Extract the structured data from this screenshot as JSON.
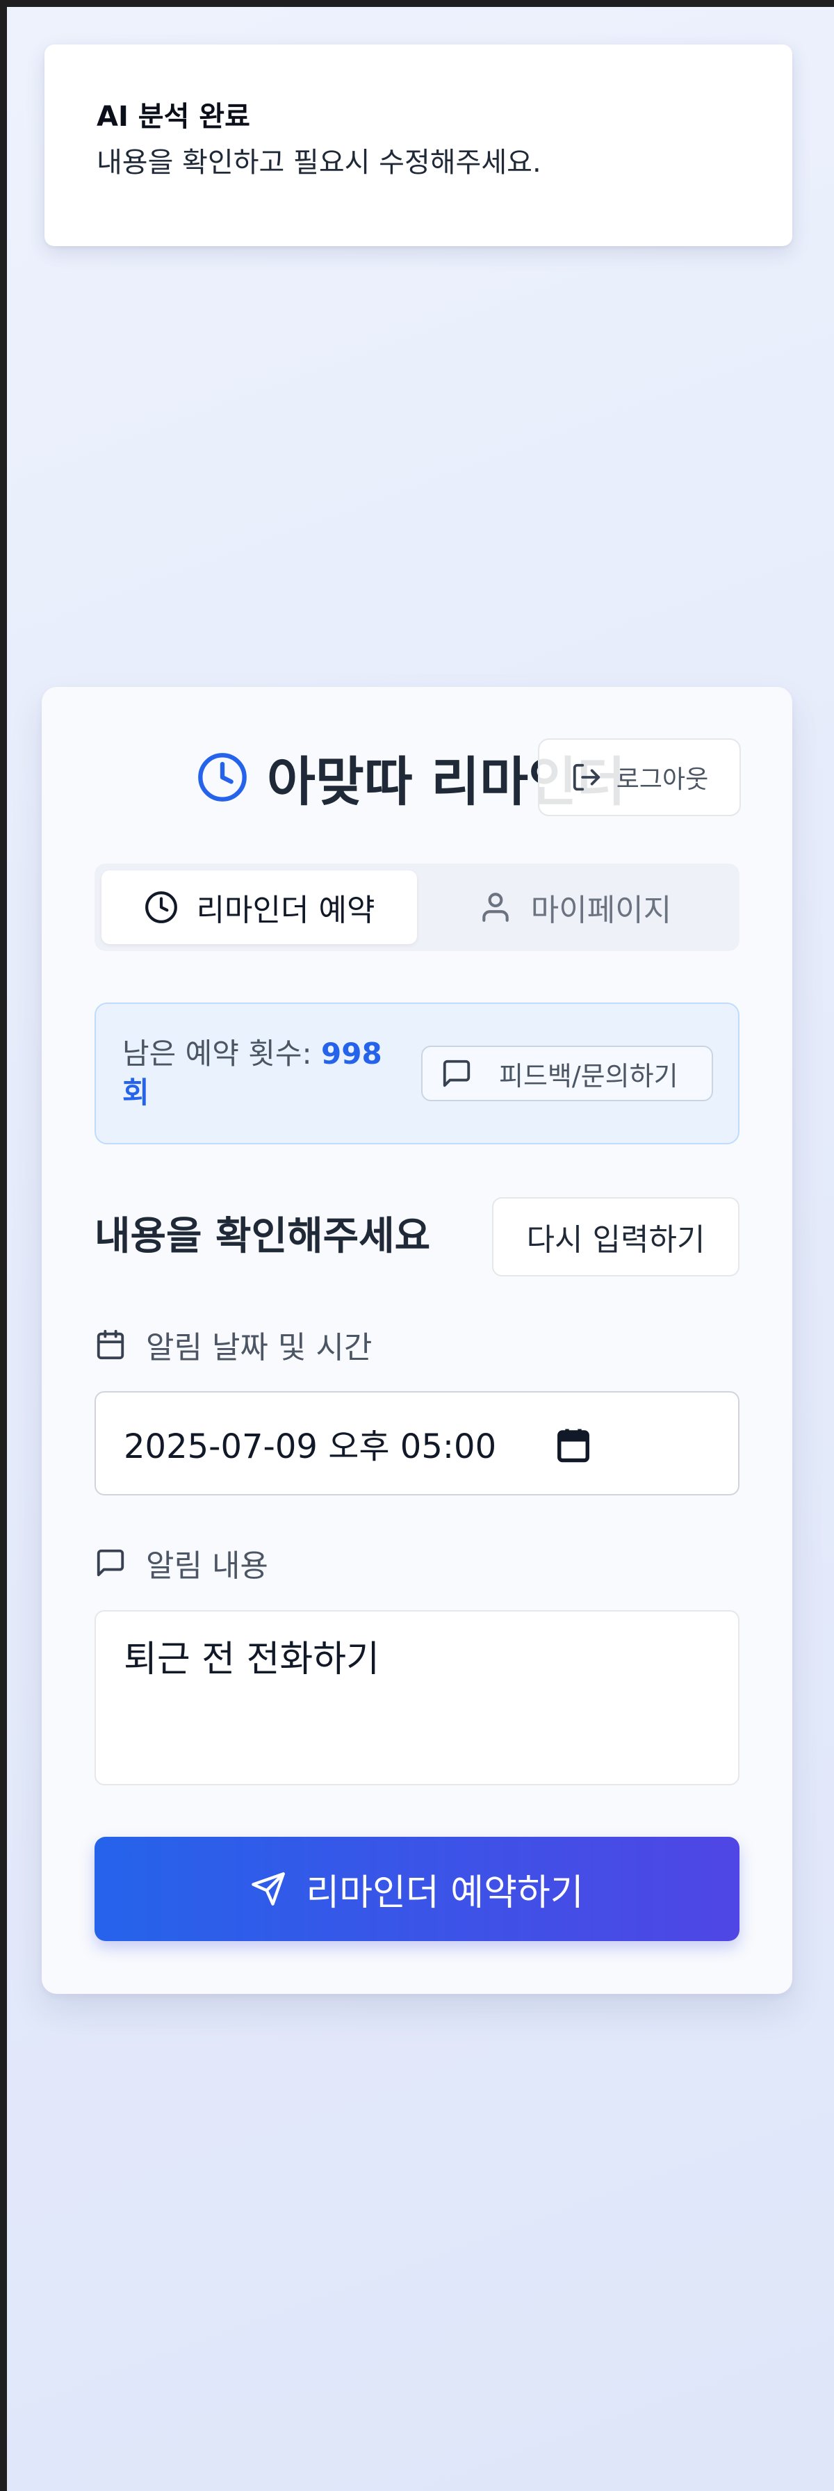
{
  "toast": {
    "title": "AI 분석 완료",
    "message": "내용을 확인하고 필요시 수정해주세요."
  },
  "header": {
    "title": "아맞따 리마인더",
    "logout_label": "로그아웃",
    "icon": "clock-icon"
  },
  "tabs": [
    {
      "label": "리마인더 예약",
      "icon": "clock-icon",
      "active": true
    },
    {
      "label": "마이페이지",
      "icon": "user-icon",
      "active": false
    }
  ],
  "quota": {
    "label": "남은 예약 횟수: ",
    "count": "998",
    "unit": "회",
    "feedback_label": "피드백/문의하기"
  },
  "confirm": {
    "title": "내용을 확인해주세요",
    "reenter_label": "다시 입력하기"
  },
  "form": {
    "datetime_label": "알림 날짜 및 시간",
    "datetime_value": "2025-07-09 오후 05:00",
    "content_label": "알림 내용",
    "content_value": "퇴근 전 전화하기"
  },
  "submit": {
    "label": "리마인더 예약하기"
  },
  "colors": {
    "accent": "#2563eb",
    "accent_end": "#4f46e5",
    "quota_bg": "#eaf2fe"
  }
}
